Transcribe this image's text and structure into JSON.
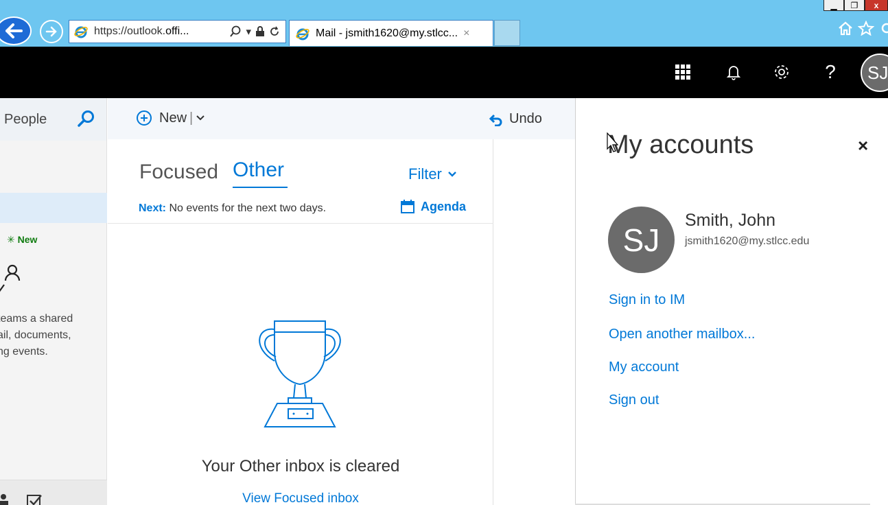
{
  "browser": {
    "url_prefix": "https://outlook.",
    "url_host": "offi...",
    "tab_title": "Mail - jsmith1620@my.stlcc...",
    "tab_close": "×",
    "window_controls": {
      "minimize": "▁",
      "restore": "❐",
      "close": "x"
    }
  },
  "suite": {
    "avatar_initials": "SJ",
    "help": "?"
  },
  "left": {
    "search_text": "l People",
    "new_badge": "New",
    "groups_text_1": "teams a shared",
    "groups_text_2": "ail, documents,",
    "groups_text_3": "ng events."
  },
  "commands": {
    "new_label": "New",
    "separator": "|",
    "undo_label": "Undo"
  },
  "inbox": {
    "tab_focused": "Focused",
    "tab_other": "Other",
    "filter_label": "Filter",
    "next_label": "Next:",
    "next_text": "No events for the next two days.",
    "agenda_label": "Agenda",
    "empty_message": "Your Other inbox is cleared",
    "view_focused_link": "View Focused inbox"
  },
  "accounts_panel": {
    "title": "My accounts",
    "close": "×",
    "avatar_initials": "SJ",
    "name": "Smith, John",
    "email": "jsmith1620@my.stlcc.edu",
    "links": [
      "Sign in to IM",
      "Open another mailbox...",
      "My account",
      "Sign out"
    ]
  },
  "colors": {
    "accent": "#0078d7",
    "chrome": "#6ec6f0",
    "suite_bar": "#000000",
    "avatar": "#6b6b6b"
  }
}
